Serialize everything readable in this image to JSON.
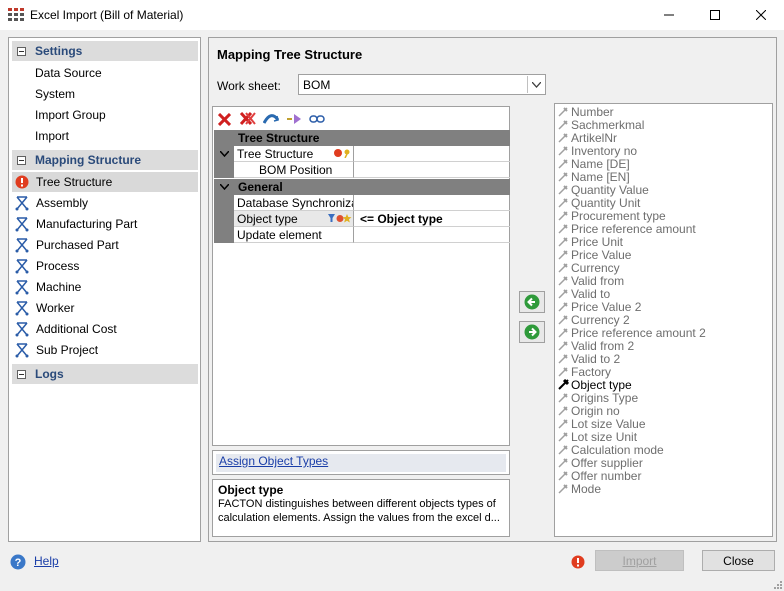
{
  "window": {
    "title": "Excel Import (Bill of Material)"
  },
  "sidebar": {
    "settings_label": "Settings",
    "settings_items": [
      "Data Source",
      "System",
      "Import Group",
      "Import"
    ],
    "mapping_label": "Mapping Structure",
    "mapping_items": [
      {
        "label": "Tree Structure",
        "icon": "error-icon",
        "selected": true
      },
      {
        "label": "Assembly",
        "icon": "structure-icon"
      },
      {
        "label": "Manufacturing Part",
        "icon": "structure-icon"
      },
      {
        "label": "Purchased Part",
        "icon": "structure-icon"
      },
      {
        "label": "Process",
        "icon": "structure-icon"
      },
      {
        "label": "Machine",
        "icon": "structure-icon"
      },
      {
        "label": "Worker",
        "icon": "structure-icon"
      },
      {
        "label": "Additional Cost",
        "icon": "structure-icon"
      },
      {
        "label": "Sub Project",
        "icon": "structure-icon"
      }
    ],
    "logs_label": "Logs"
  },
  "main": {
    "title": "Mapping Tree Structure",
    "worksheet_label": "Work sheet:",
    "worksheet_value": "BOM",
    "grid": {
      "cat_tree": "Tree Structure",
      "row_tree_structure": "Tree Structure",
      "row_bom_position": "BOM Position",
      "cat_general": "General",
      "row_db_sync": "Database Synchronizat",
      "row_object_type": "Object type",
      "row_object_type_value": "<= Object type",
      "row_update": "Update element"
    },
    "assign_link": "Assign Object Types",
    "description": {
      "title": "Object type",
      "text": "FACTON distinguishes between different objects types of calculation elements. Assign the values from the excel d..."
    }
  },
  "fields": [
    {
      "label": "Number",
      "active": false
    },
    {
      "label": "Sachmerkmal",
      "active": false
    },
    {
      "label": "ArtikelNr",
      "active": false
    },
    {
      "label": "Inventory no",
      "active": false
    },
    {
      "label": "Name [DE]",
      "active": false
    },
    {
      "label": "Name [EN]",
      "active": false
    },
    {
      "label": "Quantity Value",
      "active": false
    },
    {
      "label": "Quantity Unit",
      "active": false
    },
    {
      "label": "Procurement type",
      "active": false
    },
    {
      "label": "Price reference amount",
      "active": false
    },
    {
      "label": "Price Unit",
      "active": false
    },
    {
      "label": "Price Value",
      "active": false
    },
    {
      "label": "Currency",
      "active": false
    },
    {
      "label": "Valid from",
      "active": false
    },
    {
      "label": "Valid to",
      "active": false
    },
    {
      "label": "Price Value 2",
      "active": false
    },
    {
      "label": "Currency 2",
      "active": false
    },
    {
      "label": "Price reference amount 2",
      "active": false
    },
    {
      "label": "Valid from 2",
      "active": false
    },
    {
      "label": "Valid to 2",
      "active": false
    },
    {
      "label": "Factory",
      "active": false
    },
    {
      "label": "Object type",
      "active": true
    },
    {
      "label": "Origins Type",
      "active": false
    },
    {
      "label": "Origin no",
      "active": false
    },
    {
      "label": "Lot size Value",
      "active": false
    },
    {
      "label": "Lot size Unit",
      "active": false
    },
    {
      "label": "Calculation mode",
      "active": false
    },
    {
      "label": "Offer supplier",
      "active": false
    },
    {
      "label": "Offer number",
      "active": false
    },
    {
      "label": "Mode",
      "active": false
    }
  ],
  "footer": {
    "help_label": "Help",
    "import_label": "Import",
    "close_label": "Close"
  },
  "colors": {
    "section_header_text": "#2a4a7a",
    "link": "#1a3ea8",
    "error": "#e03c1f",
    "structure_icon": "#2a5ca8"
  }
}
